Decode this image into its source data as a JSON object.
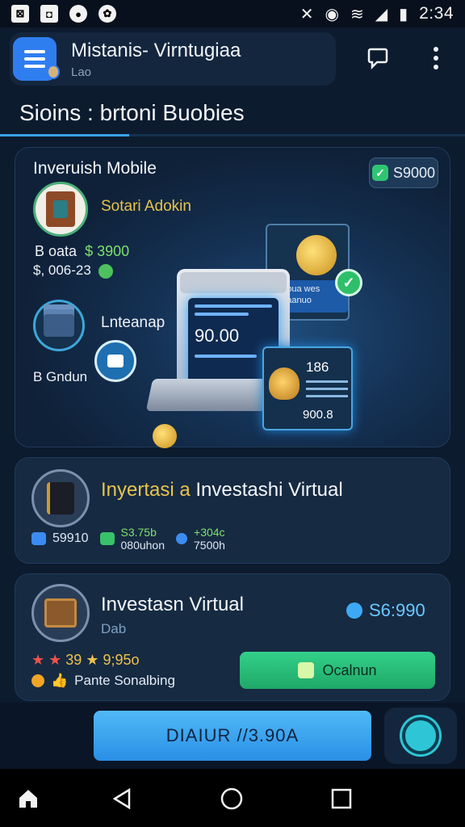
{
  "statusbar": {
    "time": "2:34"
  },
  "appbar": {
    "title": "Mistanis- Virntugiaa",
    "subtitle": "Lao"
  },
  "page": {
    "title": "Sioins : brtoni Buobies"
  },
  "hero": {
    "title": "Inveruish Mobile",
    "pill": "S9000",
    "sotari_label": "Sotari Adokin",
    "stat1_label": "B oata",
    "stat1_value": "$ 3900",
    "stat2": "$, 006-23",
    "lnt_label": "Lnteanap",
    "bgd_label": "B Gndun",
    "device_amount": "90.00",
    "panel_gold_line1": "Lubua wes",
    "panel_gold_line2": "Laaanuo",
    "bag_value": "186",
    "bag_total": "900.8"
  },
  "card2": {
    "title_prefix": "Inyertasi a",
    "title_main": "Investashi Virtual",
    "meta_value": "59910",
    "col1_top": "S3.75b",
    "col1_bottom": "080uhon",
    "col2_top": "+304c",
    "col2_bottom": "7500h"
  },
  "card3": {
    "title": "Investasn Virtual",
    "subtitle": "Dab",
    "price": "S6:990",
    "stars": "39 ★ 9;95o",
    "rating_label": "Pante Sonalbing",
    "button_label": "Ocalnun"
  },
  "bottom": {
    "main_button": "DIAIUR //3.90A"
  },
  "colors": {
    "accent": "#3aa3e6",
    "success": "#2fc572",
    "gold": "#e9c44d",
    "background": "#0d1b2e"
  }
}
